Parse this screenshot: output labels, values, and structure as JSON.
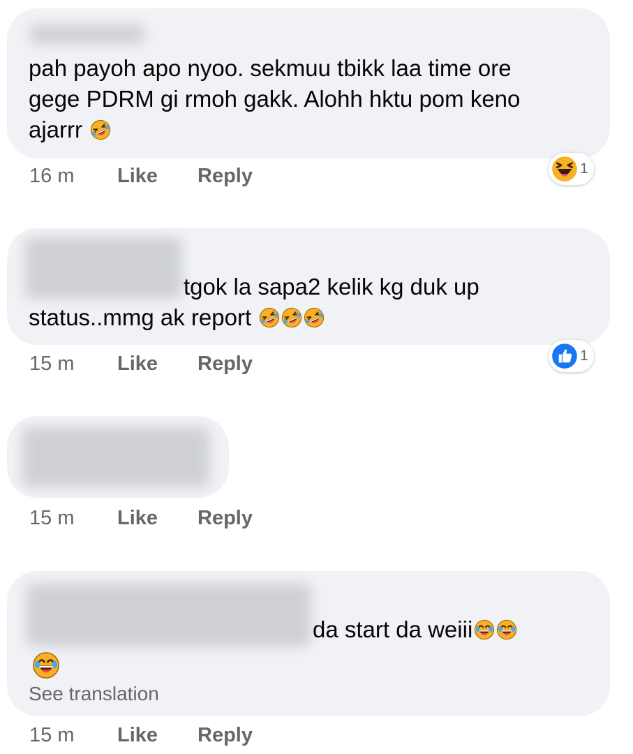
{
  "colors": {
    "bubble": "#f0f2f5",
    "meta_text": "#65676b",
    "like_blue": "#1877f2",
    "emoji_yellow": "#f7b125"
  },
  "comments": [
    {
      "text_lines": [
        "pah payoh apo nyoo. sekmuu tbikk laa time ore",
        "gege PDRM gi rmoh gakk. Alohh hktu pom keno",
        "ajarrr"
      ],
      "emojis": [
        "rolling-laughing-icon"
      ],
      "time": "16 m",
      "like_label": "Like",
      "reply_label": "Reply",
      "reaction": {
        "icon": "haha-reaction-icon",
        "count": "1"
      }
    },
    {
      "text_lines": [
        "tgok la sapa2 kelik kg duk up",
        "status..mmg ak report"
      ],
      "emojis": [
        "rolling-laughing-icon",
        "rolling-laughing-icon",
        "rolling-laughing-icon"
      ],
      "time": "15 m",
      "like_label": "Like",
      "reply_label": "Reply",
      "reaction": {
        "icon": "like-reaction-icon",
        "count": "1"
      }
    },
    {
      "text_lines": [],
      "time": "15 m",
      "like_label": "Like",
      "reply_label": "Reply"
    },
    {
      "text_lines": [
        "da start da weiii"
      ],
      "emojis": [
        "tears-of-joy-icon",
        "tears-of-joy-icon",
        "tears-of-joy-icon"
      ],
      "see_translation": "See translation",
      "time": "15 m",
      "like_label": "Like",
      "reply_label": "Reply"
    }
  ]
}
